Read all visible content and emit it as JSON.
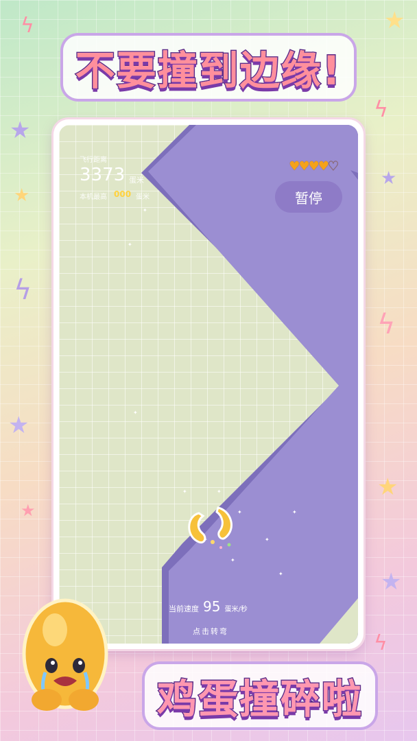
{
  "headline": {
    "top": "不要撞到边缘!",
    "bottom": "鸡蛋撞碎啦"
  },
  "hud": {
    "distance_label": "飞行距离",
    "distance_value": "3373",
    "distance_unit": "蛋米",
    "best_label": "本机最高",
    "best_value": "000",
    "best_unit": "蛋米",
    "lives_total": 5,
    "lives_remaining": 4,
    "pause_label": "暂停"
  },
  "footer": {
    "speed_label": "当前速度",
    "speed_value": "95",
    "speed_unit": "蛋米/秒",
    "tap_hint": "点击转弯"
  },
  "colors": {
    "track": "#9b8ed2",
    "track_edge": "#7d6fbb",
    "field": "#dfe6c8",
    "accent_gold": "#f4a21a",
    "pause_bg": "#8e7bc7"
  },
  "icons": {
    "heart_full": "heart-filled-icon",
    "heart_empty": "heart-outline-icon",
    "star": "star-icon",
    "bolt": "lightning-icon"
  }
}
